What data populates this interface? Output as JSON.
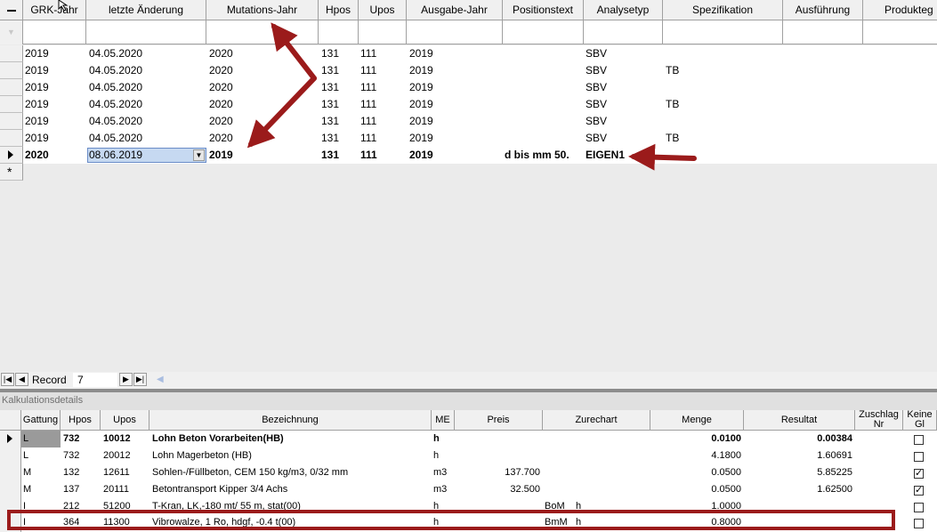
{
  "top_grid": {
    "columns": [
      "GRK-Jahr",
      "letzte Änderung",
      "Mutations-Jahr",
      "Hpos",
      "Upos",
      "Ausgabe-Jahr",
      "Positionstext",
      "Analysetyp",
      "Spezifikation",
      "Ausführung",
      "Produkteg"
    ],
    "rows": [
      [
        "2019",
        "04.05.2020",
        "2020",
        "131",
        "111",
        "2019",
        "",
        "SBV",
        ""
      ],
      [
        "2019",
        "04.05.2020",
        "2020",
        "131",
        "111",
        "2019",
        "",
        "SBV",
        "TB"
      ],
      [
        "2019",
        "04.05.2020",
        "2020",
        "131",
        "111",
        "2019",
        "",
        "SBV",
        ""
      ],
      [
        "2019",
        "04.05.2020",
        "2020",
        "131",
        "111",
        "2019",
        "",
        "SBV",
        "TB"
      ],
      [
        "2019",
        "04.05.2020",
        "2020",
        "131",
        "111",
        "2019",
        "",
        "SBV",
        ""
      ],
      [
        "2019",
        "04.05.2020",
        "2020",
        "131",
        "111",
        "2019",
        "",
        "SBV",
        "TB"
      ]
    ],
    "current_row": [
      "2020",
      "08.06.2019",
      "2019",
      "131",
      "111",
      "2019",
      "d bis mm 50.",
      "EIGEN1",
      ""
    ],
    "new_row_marker": "*"
  },
  "record_nav": {
    "label": "Record",
    "current": "7"
  },
  "details": {
    "title": "Kalkulationsdetails",
    "columns": [
      "Gattung",
      "Hpos",
      "Upos",
      "Bezeichnung",
      "ME",
      "Preis",
      "Zurechart",
      "Menge",
      "Resultat",
      "Zuschlag Nr",
      "Keine Gl"
    ],
    "rows": [
      {
        "gattung": "L",
        "hpos": "732",
        "upos": "10012",
        "bez": "Lohn Beton Vorarbeiten(HB)",
        "me": "h",
        "preis": "",
        "zurechart": "",
        "zunit": "",
        "menge": "0.0100",
        "resultat": "0.00384",
        "checked": false,
        "bold": true
      },
      {
        "gattung": "L",
        "hpos": "732",
        "upos": "20012",
        "bez": "Lohn Magerbeton (HB)",
        "me": "h",
        "preis": "",
        "zurechart": "",
        "zunit": "",
        "menge": "4.1800",
        "resultat": "1.60691",
        "checked": false,
        "bold": false
      },
      {
        "gattung": "M",
        "hpos": "132",
        "upos": "12611",
        "bez": "Sohlen-/Füllbeton, CEM 150 kg/m3,  0/32 mm",
        "me": "m3",
        "preis": "137.700",
        "zurechart": "",
        "zunit": "",
        "menge": "0.0500",
        "resultat": "5.85225",
        "checked": true,
        "bold": false
      },
      {
        "gattung": "M",
        "hpos": "137",
        "upos": "20111",
        "bez": "Betontransport Kipper 3/4 Achs",
        "me": "m3",
        "preis": "32.500",
        "zurechart": "",
        "zunit": "",
        "menge": "0.0500",
        "resultat": "1.62500",
        "checked": true,
        "bold": false
      },
      {
        "gattung": "I",
        "hpos": "212",
        "upos": "51200",
        "bez": "T-Kran, LK,-180 mt/ 55 m, stat(00)",
        "me": "h",
        "preis": "",
        "zurechart": "BoM",
        "zunit": "h",
        "menge": "1.0000",
        "resultat": "",
        "checked": false,
        "bold": false
      },
      {
        "gattung": "I",
        "hpos": "364",
        "upos": "11300",
        "bez": "Vibrowalze, 1 Ro, hdgf, -0.4 t(00)",
        "me": "h",
        "preis": "",
        "zurechart": "BmM",
        "zunit": "h",
        "menge": "0.8000",
        "resultat": "",
        "checked": false,
        "bold": false
      }
    ]
  },
  "colors": {
    "annotation": "#9b1b1b",
    "selection": "#c6d9f1",
    "grid_bg": "#ffffff",
    "empty_bg": "#ebebeb"
  }
}
